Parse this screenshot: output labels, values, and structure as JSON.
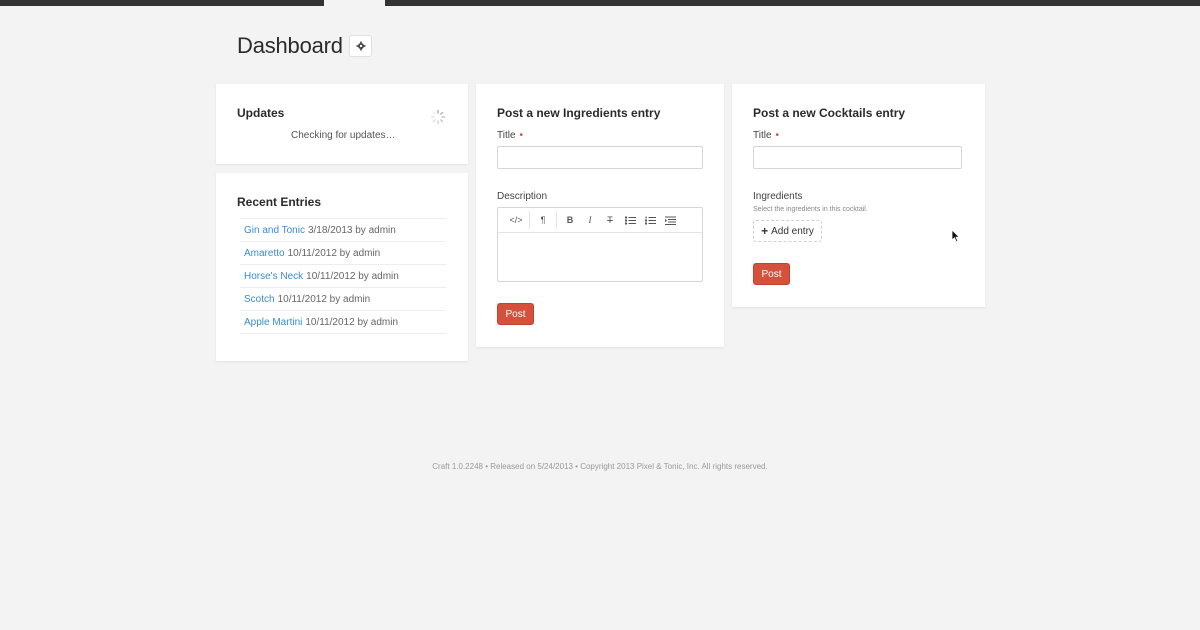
{
  "page": {
    "title": "Dashboard"
  },
  "widgets": {
    "updates": {
      "title": "Updates",
      "status": "Checking for updates…"
    },
    "recent_entries": {
      "title": "Recent Entries",
      "items": [
        {
          "title": "Gin and Tonic",
          "meta": "3/18/2013 by admin"
        },
        {
          "title": "Amaretto",
          "meta": "10/11/2012 by admin"
        },
        {
          "title": "Horse's Neck",
          "meta": "10/11/2012 by admin"
        },
        {
          "title": "Scotch",
          "meta": "10/11/2012 by admin"
        },
        {
          "title": "Apple Martini",
          "meta": "10/11/2012 by admin"
        }
      ]
    },
    "ingredients_form": {
      "title": "Post a new Ingredients entry",
      "title_label": "Title",
      "title_value": "",
      "description_label": "Description",
      "toolbar": {
        "html": "</>",
        "paragraph": "¶",
        "bold": "B",
        "italic": "I",
        "strike": "T"
      },
      "post_label": "Post"
    },
    "cocktails_form": {
      "title": "Post a new Cocktails entry",
      "title_label": "Title",
      "title_value": "",
      "ingredients_label": "Ingredients",
      "ingredients_help": "Select the ingredients in this cocktail.",
      "add_entry_label": "Add entry",
      "post_label": "Post"
    }
  },
  "required_mark": "•",
  "footer": {
    "text": "Craft 1.0.2248  •  Released on 5/24/2013  •  Copyright 2013 Pixel & Tonic, Inc. All rights reserved."
  },
  "colors": {
    "accent": "#d6503e",
    "link": "#3a8bd4",
    "background": "#f3f3f3"
  }
}
